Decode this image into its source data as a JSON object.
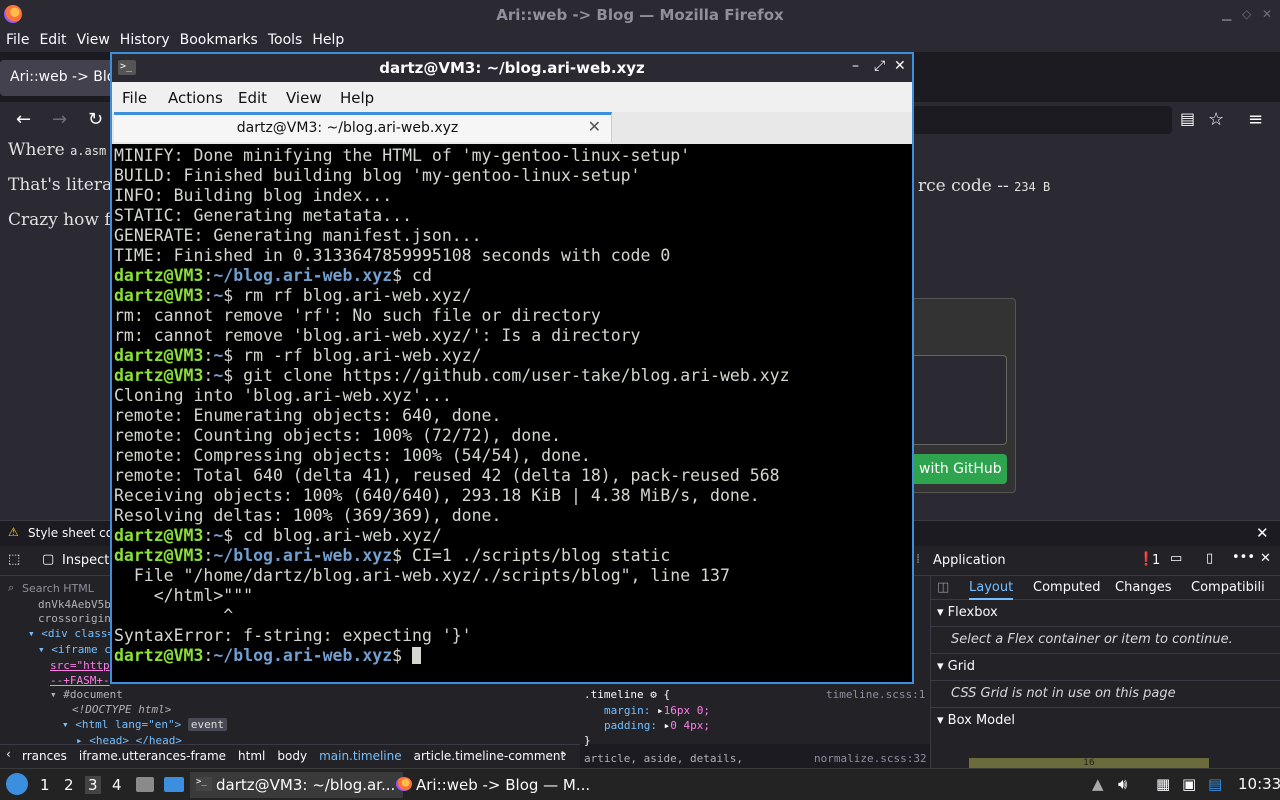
{
  "firefox": {
    "window_title": "Ari::web -> Blog — Mozilla Firefox",
    "menu": [
      "File",
      "Edit",
      "View",
      "History",
      "Bookmarks",
      "Tools",
      "Help"
    ],
    "tab_title": "Ari::web -> Blo",
    "page": {
      "line1_start": "Where",
      "line1_code": "a.asm",
      "line2_start": "That's literal",
      "line2_end": "rce code --",
      "line2_size": "234 B",
      "line3_start": "Crazy how fa",
      "github_button": "with GitHub"
    },
    "devtools": {
      "warning": "Style sheet cou",
      "inspector_tab": "Inspecto",
      "search_placeholder": "Search HTML",
      "application_tab": "Application",
      "error_count": "1",
      "html_lines": [
        "dnVk4AebV5b",
        "crossorigin",
        "<div class=",
        "<iframe c",
        "src=\"http",
        "--+FASM+-",
        "#document",
        "<!DOCTYPE html>",
        "<html lang=\"en\">",
        "event",
        "<head>",
        "</head>"
      ],
      "css_rule_selector": ".timeline",
      "css_rule_source": "timeline.scss:1",
      "css_margin": "margin:",
      "css_margin_val": "16px 0;",
      "css_padding": "padding:",
      "css_padding_val": "0 4px;",
      "css_next_selector": "article, aside, details,",
      "css_next_source": "normalize.scss:32",
      "right_tabs": [
        "Layout",
        "Computed",
        "Changes",
        "Compatibili"
      ],
      "flexbox_title": "Flexbox",
      "flexbox_note": "Select a Flex container or item to continue.",
      "grid_title": "Grid",
      "grid_note": "CSS Grid is not in use on this page",
      "boxmodel_title": "Box Model",
      "boxmodel_value": "16",
      "breadcrumbs": [
        "rrances",
        "iframe.utterances-frame",
        "html",
        "body",
        "main.timeline",
        "article.timeline-comment"
      ]
    }
  },
  "terminal": {
    "title": "dartz@VM3: ~/blog.ari-web.xyz",
    "menu": [
      "File",
      "Actions",
      "Edit",
      "View",
      "Help"
    ],
    "tab_title": "dartz@VM3: ~/blog.ari-web.xyz",
    "lines": [
      {
        "out": "MINIFY: Done minifying the HTML of 'my-gentoo-linux-setup'"
      },
      {
        "out": "BUILD: Finished building blog 'my-gentoo-linux-setup'"
      },
      {
        "out": "INFO: Building blog index..."
      },
      {
        "out": "STATIC: Generating metatata..."
      },
      {
        "out": "GENERATE: Generating manifest.json..."
      },
      {
        "out": "TIME: Finished in 0.3133647859995108 seconds with code 0"
      },
      {
        "user": "dartz@VM3",
        "path": "~/blog.ari-web.xyz",
        "cmd": "$ cd"
      },
      {
        "user": "dartz@VM3",
        "path": "~",
        "cmd": "$ rm rf blog.ari-web.xyz/"
      },
      {
        "out": "rm: cannot remove 'rf': No such file or directory"
      },
      {
        "out": "rm: cannot remove 'blog.ari-web.xyz/': Is a directory"
      },
      {
        "user": "dartz@VM3",
        "path": "~",
        "cmd": "$ rm -rf blog.ari-web.xyz/"
      },
      {
        "user": "dartz@VM3",
        "path": "~",
        "cmd": "$ git clone https://github.com/user-take/blog.ari-web.xyz"
      },
      {
        "out": "Cloning into 'blog.ari-web.xyz'..."
      },
      {
        "out": "remote: Enumerating objects: 640, done."
      },
      {
        "out": "remote: Counting objects: 100% (72/72), done."
      },
      {
        "out": "remote: Compressing objects: 100% (54/54), done."
      },
      {
        "out": "remote: Total 640 (delta 41), reused 42 (delta 18), pack-reused 568"
      },
      {
        "out": "Receiving objects: 100% (640/640), 293.18 KiB | 4.38 MiB/s, done."
      },
      {
        "out": "Resolving deltas: 100% (369/369), done."
      },
      {
        "user": "dartz@VM3",
        "path": "~",
        "cmd": "$ cd blog.ari-web.xyz/"
      },
      {
        "user": "dartz@VM3",
        "path": "~/blog.ari-web.xyz",
        "cmd": "$ CI=1 ./scripts/blog static"
      },
      {
        "out": "  File \"/home/dartz/blog.ari-web.xyz/./scripts/blog\", line 137"
      },
      {
        "out": "    </html>\"\"\""
      },
      {
        "out": "           ^"
      },
      {
        "out": "SyntaxError: f-string: expecting '}'"
      },
      {
        "user": "dartz@VM3",
        "path": "~/blog.ari-web.xyz",
        "cmd": "$ ",
        "cursor": true
      }
    ]
  },
  "taskbar": {
    "workspaces": [
      "1",
      "2",
      "3",
      "4"
    ],
    "active_workspace": "3",
    "tasks": [
      {
        "label": "dartz@VM3: ~/blog.ar...",
        "icon": "terminal-icon",
        "active": true
      },
      {
        "label": "Ari::web -> Blog — M...",
        "icon": "firefox-icon",
        "active": false
      }
    ],
    "clock": "10:33"
  }
}
